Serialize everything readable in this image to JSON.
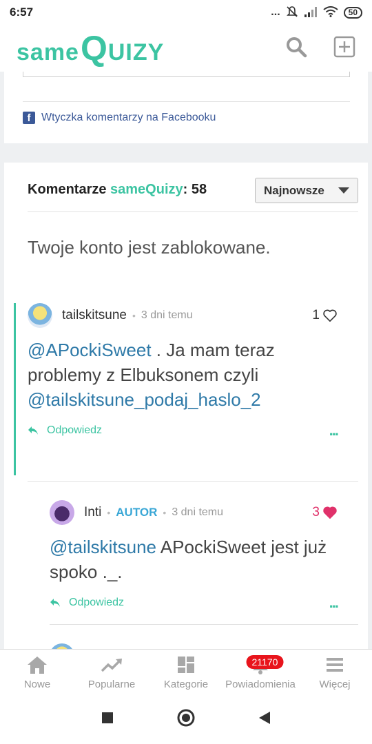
{
  "status_bar": {
    "time": "6:57",
    "signal_dots": "...",
    "battery": "50"
  },
  "app_header": {
    "logo_part1": "same",
    "logo_part2": "Q",
    "logo_part3": "UIZY"
  },
  "facebook_plugin": {
    "label": "Wtyczka komentarzy na Facebooku"
  },
  "comments": {
    "header_prefix": "Komentarze ",
    "header_brand": "sameQuizy",
    "header_suffix": ": ",
    "count": "58",
    "sort_label": "Najnowsze",
    "blocked_message": "Twoje konto jest zablokowane.",
    "items": [
      {
        "user": "tailskitsune",
        "date": "3 dni temu",
        "likes": "1",
        "body_mention1": "@APockiSweet",
        "body_text1": " . Ja mam teraz problemy z Elbuksonem czyli ",
        "body_mention2": "@tailskitsune_podaj_haslo_2",
        "reply_label": "Odpowiedz",
        "more": "..."
      },
      {
        "user": "Inti",
        "author_tag": "AUTOR",
        "date": "3 dni temu",
        "likes": "3",
        "body_mention1": "@tailskitsune",
        "body_text1": " APockiSweet jest już spoko ._.",
        "reply_label": "Odpowiedz",
        "more": "..."
      }
    ]
  },
  "bottom_nav": {
    "items": [
      {
        "label": "Nowe",
        "icon": "home-icon"
      },
      {
        "label": "Popularne",
        "icon": "trending-icon"
      },
      {
        "label": "Kategorie",
        "icon": "grid-icon"
      },
      {
        "label": "Powiadomienia",
        "icon": "bell-icon",
        "badge": "21170"
      },
      {
        "label": "Więcej",
        "icon": "menu-icon"
      }
    ]
  },
  "colors": {
    "brand": "#3cc4a2",
    "mention": "#2f7aa8",
    "author": "#3aa7d6",
    "like": "#e0316a",
    "badge": "#e8141c",
    "facebook": "#3b5998"
  }
}
